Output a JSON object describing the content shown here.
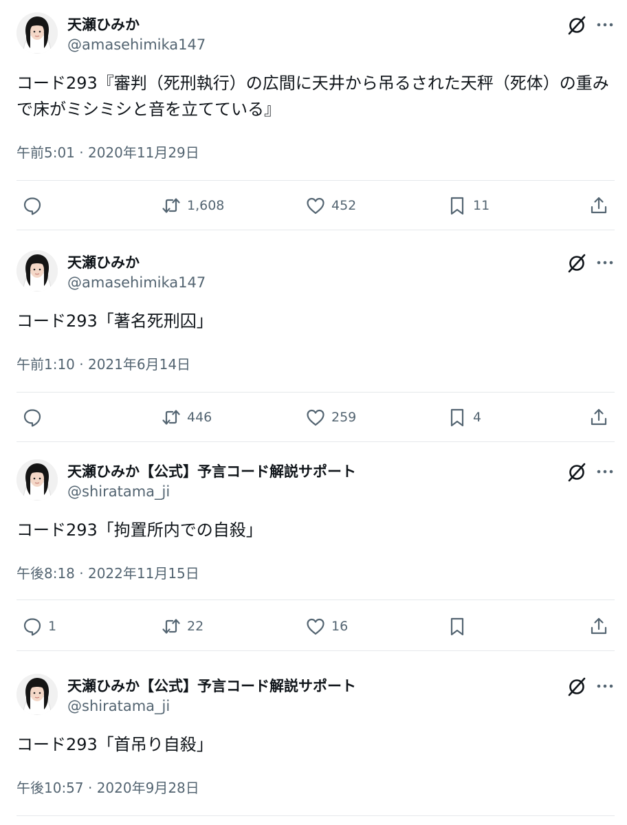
{
  "tweets": [
    {
      "display_name": "天瀬ひみか",
      "handle": "@amasehimika147",
      "text": "コード293『審判（死刑執行）の広間に天井から吊るされた天秤（死体）の重みで床がミシミシと音を立てている』",
      "timestamp": "午前5:01 · 2020年11月29日",
      "replies": "",
      "retweets": "1,608",
      "likes": "452",
      "bookmarks": "11"
    },
    {
      "display_name": "天瀬ひみか",
      "handle": "@amasehimika147",
      "text": "コード293「著名死刑囚」",
      "timestamp": "午前1:10 · 2021年6月14日",
      "replies": "",
      "retweets": "446",
      "likes": "259",
      "bookmarks": "4"
    },
    {
      "display_name": "天瀬ひみか【公式】予言コード解説サポート",
      "handle": "@shiratama_ji",
      "text": "コード293「拘置所内での自殺」",
      "timestamp": "午後8:18 · 2022年11月15日",
      "replies": "1",
      "retweets": "22",
      "likes": "16",
      "bookmarks": ""
    },
    {
      "display_name": "天瀬ひみか【公式】予言コード解説サポート",
      "handle": "@shiratama_ji",
      "text": "コード293「首吊り自殺」",
      "timestamp": "午後10:57 · 2020年9月28日"
    }
  ],
  "icons": {
    "grok": "grok-icon",
    "more": "more-icon",
    "reply": "reply-icon",
    "retweet": "retweet-icon",
    "like": "like-icon",
    "bookmark": "bookmark-icon",
    "share": "share-icon"
  },
  "colors": {
    "text": "#0f1419",
    "secondary": "#536471",
    "divider": "#e5e8eb"
  }
}
